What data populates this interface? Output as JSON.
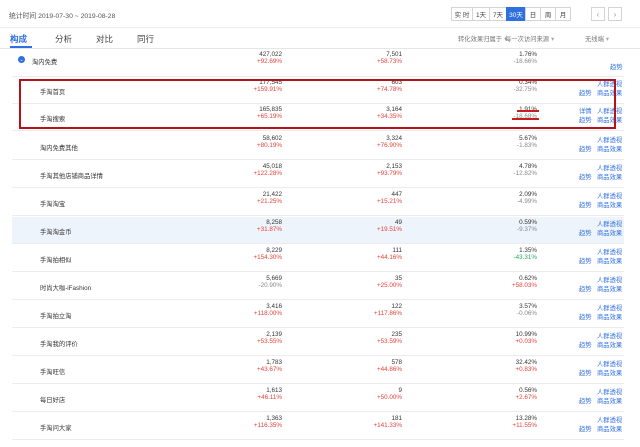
{
  "header": {
    "date_label": "统计时间 2019-07-30 ~ 2019-08-28",
    "periods": [
      "实 时",
      "1天",
      "7天",
      "30天",
      "日",
      "周",
      "月"
    ],
    "active_period": "30天",
    "prev_icon": "chevron-left-icon",
    "next_icon": "chevron-right-icon",
    "accent_color": "#2f6fe0"
  },
  "tabs": {
    "items": [
      "构成",
      "分析",
      "对比",
      "同行"
    ],
    "active": "构成",
    "filter_1": "转化效果归属于",
    "filter_2": "每一次访问来源",
    "filter_3": "无线端"
  },
  "rows": [
    {
      "name": "淘内免费",
      "v1": "427,022",
      "c1": "+92.69%",
      "v2": "7,501",
      "c2": "+58.73%",
      "v3": "1.76%",
      "c3": "-18.66%",
      "a1": "趋势",
      "a2": "",
      "a3": ""
    },
    {
      "name": "手淘首页",
      "v1": "177,545",
      "c1": "+159.91%",
      "v2": "603",
      "c2": "+74.78%",
      "v3": "0.34%",
      "c3": "-32.75%",
      "a1": "趋势",
      "a2": "人群透视",
      "a3": "商品效果"
    },
    {
      "name": "手淘搜索",
      "v1": "165,835",
      "c1": "+65.19%",
      "v2": "3,164",
      "c2": "+34.35%",
      "v3": "1.91%",
      "c3": "-18.68%",
      "a1": "详情",
      "a2": "人群透视",
      "a3": "商品效果",
      "a4": "趋势"
    },
    {
      "name": "淘内免费其他",
      "v1": "58,602",
      "c1": "+80.19%",
      "v2": "3,324",
      "c2": "+76.90%",
      "v3": "5.67%",
      "c3": "-1.83%",
      "a1": "趋势",
      "a2": "人群透视",
      "a3": "商品效果"
    },
    {
      "name": "手淘其他店铺商品详情",
      "v1": "45,018",
      "c1": "+122.28%",
      "v2": "2,153",
      "c2": "+93.79%",
      "v3": "4.78%",
      "c3": "-12.82%",
      "a1": "趋势",
      "a2": "人群透视",
      "a3": "商品效果"
    },
    {
      "name": "手淘淘宝",
      "v1": "21,422",
      "c1": "+21.25%",
      "v2": "447",
      "c2": "+15.21%",
      "v3": "2.09%",
      "c3": "-4.99%",
      "a1": "趋势",
      "a2": "人群透视",
      "a3": "商品效果"
    },
    {
      "name": "手淘淘金币",
      "v1": "8,258",
      "c1": "+31.87%",
      "v2": "49",
      "c2": "+19.51%",
      "v3": "0.59%",
      "c3": "-9.37%",
      "a1": "趋势",
      "a2": "人群透视",
      "a3": "商品效果"
    },
    {
      "name": "手淘拍相似",
      "v1": "8,229",
      "c1": "+154.30%",
      "v2": "111",
      "c2": "+44.16%",
      "v3": "1.35%",
      "c3": "-43.31%",
      "a1": "趋势",
      "a2": "人群透视",
      "a3": "商品效果"
    },
    {
      "name": "时尚大咖-iFashion",
      "v1": "5,669",
      "c1": "-20.90%",
      "v2": "35",
      "c2": "+25.00%",
      "v3": "0.62%",
      "c3": "+58.03%",
      "a1": "趋势",
      "a2": "人群透视",
      "a3": "商品效果"
    },
    {
      "name": "手淘拍立淘",
      "v1": "3,416",
      "c1": "+118.00%",
      "v2": "122",
      "c2": "+117.86%",
      "v3": "3.57%",
      "c3": "-0.06%",
      "a1": "趋势",
      "a2": "人群透视",
      "a3": "商品效果"
    },
    {
      "name": "手淘我的评价",
      "v1": "2,139",
      "c1": "+53.55%",
      "v2": "235",
      "c2": "+53.59%",
      "v3": "10.99%",
      "c3": "+0.03%",
      "a1": "趋势",
      "a2": "人群透视",
      "a3": "商品效果"
    },
    {
      "name": "手淘旺信",
      "v1": "1,783",
      "c1": "+43.67%",
      "v2": "578",
      "c2": "+44.86%",
      "v3": "32.42%",
      "c3": "+0.83%",
      "a1": "趋势",
      "a2": "人群透视",
      "a3": "商品效果"
    },
    {
      "name": "每日好店",
      "v1": "1,613",
      "c1": "+46.11%",
      "v2": "9",
      "c2": "+50.00%",
      "v3": "0.56%",
      "c3": "+2.67%",
      "a1": "趋势",
      "a2": "人群透视",
      "a3": "商品效果"
    },
    {
      "name": "手淘问大家",
      "v1": "1,363",
      "c1": "+116.35%",
      "v2": "181",
      "c2": "+141.33%",
      "v3": "13.28%",
      "c3": "+11.55%",
      "a1": "趋势",
      "a2": "人群透视",
      "a3": "商品效果"
    }
  ],
  "colors": {
    "up": "#e8413a",
    "down": "#888888",
    "green": "#26a85b",
    "highlight_box": "#b3121f"
  }
}
